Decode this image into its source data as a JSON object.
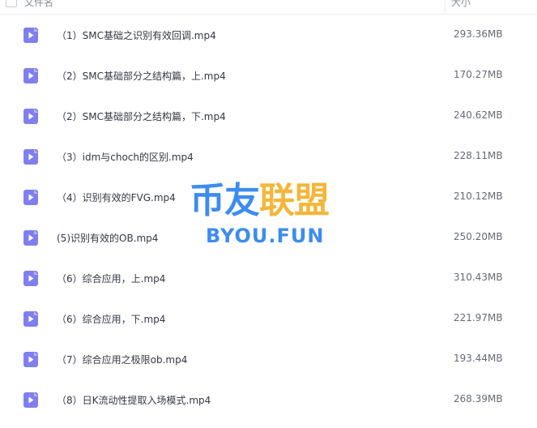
{
  "header": {
    "name_label": "文件名",
    "size_label": "大小"
  },
  "files": [
    {
      "name": "（1）SMC基础之识别有效回调.mp4",
      "size": "293.36MB",
      "icon": "video-file-icon"
    },
    {
      "name": "（2）SMC基础部分之结构篇，上.mp4",
      "size": "170.27MB",
      "icon": "video-file-icon"
    },
    {
      "name": "（2）SMC基础部分之结构篇，下.mp4",
      "size": "240.62MB",
      "icon": "video-file-icon"
    },
    {
      "name": "（3）idm与choch的区别.mp4",
      "size": "228.11MB",
      "icon": "video-file-icon"
    },
    {
      "name": "（4）识别有效的FVG.mp4",
      "size": "210.12MB",
      "icon": "video-file-icon"
    },
    {
      "name": "(5)识别有效的OB.mp4",
      "size": "250.20MB",
      "icon": "video-file-icon"
    },
    {
      "name": "（6）综合应用，上.mp4",
      "size": "310.43MB",
      "icon": "video-file-icon"
    },
    {
      "name": "（6）综合应用，下.mp4",
      "size": "221.97MB",
      "icon": "video-file-icon"
    },
    {
      "name": "（7）综合应用之极限ob.mp4",
      "size": "193.44MB",
      "icon": "video-file-icon"
    },
    {
      "name": "（8）日K流动性提取入场模式.mp4",
      "size": "268.39MB",
      "icon": "video-file-icon"
    }
  ],
  "watermark": {
    "logo_text": "币友联盟",
    "url": "BYOU.FUN"
  },
  "colors": {
    "icon": "#7f7ff0",
    "watermark_blue": "#3d8cf0",
    "watermark_gold": "#f4b63a"
  }
}
